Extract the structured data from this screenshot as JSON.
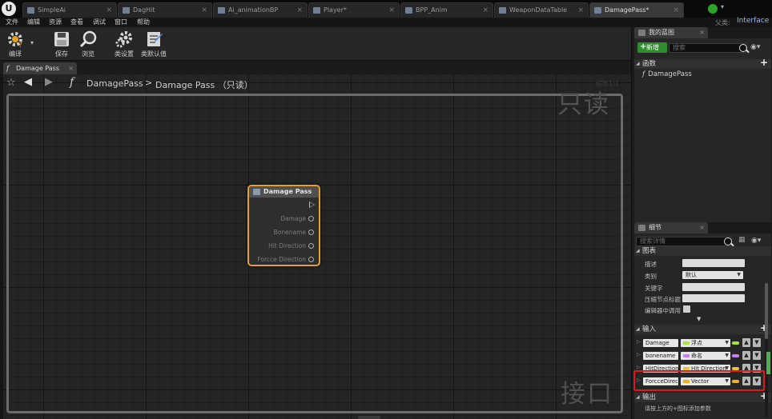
{
  "tabs": [
    {
      "label": "SimpleAi",
      "active": false
    },
    {
      "label": "DagHit",
      "active": false
    },
    {
      "label": "Ai_animationBP",
      "active": false
    },
    {
      "label": "Player*",
      "active": false
    },
    {
      "label": "BPP_Anim",
      "active": false
    },
    {
      "label": "WeaponDataTable",
      "active": false
    },
    {
      "label": "DamagePass*",
      "active": true
    }
  ],
  "parent": {
    "label": "父类:",
    "value": "Interface"
  },
  "menu": [
    "文件",
    "编辑",
    "资源",
    "查看",
    "调试",
    "窗口",
    "帮助"
  ],
  "toolbar": {
    "compile": "编译",
    "save": "保存",
    "browse": "浏览",
    "class_settings": "类设置",
    "class_defaults": "类默认值"
  },
  "graph_tab": {
    "label": "Damage Pass"
  },
  "breadcrumb": {
    "function": "DamagePass",
    "separator": ">",
    "graph": "Damage Pass （只读）"
  },
  "watermark": {
    "readonly": "只读",
    "interface": "接口",
    "zoom": "缩放1:1"
  },
  "node": {
    "title": "Damage Pass",
    "pins": [
      "Damage",
      "Bonename",
      "Hit Direction",
      "Forcce Direction"
    ]
  },
  "my_blueprint": {
    "tab": "我的蓝图",
    "new_button": "新增",
    "search_placeholder": "搜索",
    "functions_header": "函数",
    "functions": [
      "DamagePass"
    ]
  },
  "details": {
    "tab": "细节",
    "search_placeholder": "搜索详情",
    "graph_header": "图表",
    "fields": {
      "description": "描述",
      "category": "类别",
      "category_value": "默认",
      "keywords": "关键字",
      "compact_title": "压缩节点标题",
      "call_in_editor": "编辑器中调用"
    },
    "inputs_header": "输入",
    "inputs": [
      {
        "name": "Damage",
        "type": "浮点",
        "color": "#a8e43a"
      },
      {
        "name": "bonename",
        "type": "命名",
        "color": "#c77dff"
      },
      {
        "name": "HitDirection",
        "type": "Hit Direction",
        "color": "#e8c33a"
      },
      {
        "name": "ForcceDirect",
        "type": "Vector",
        "color": "#f0b21a"
      }
    ],
    "outputs_header": "输出",
    "outputs_hint": "请按上方的+图标添加参数"
  }
}
